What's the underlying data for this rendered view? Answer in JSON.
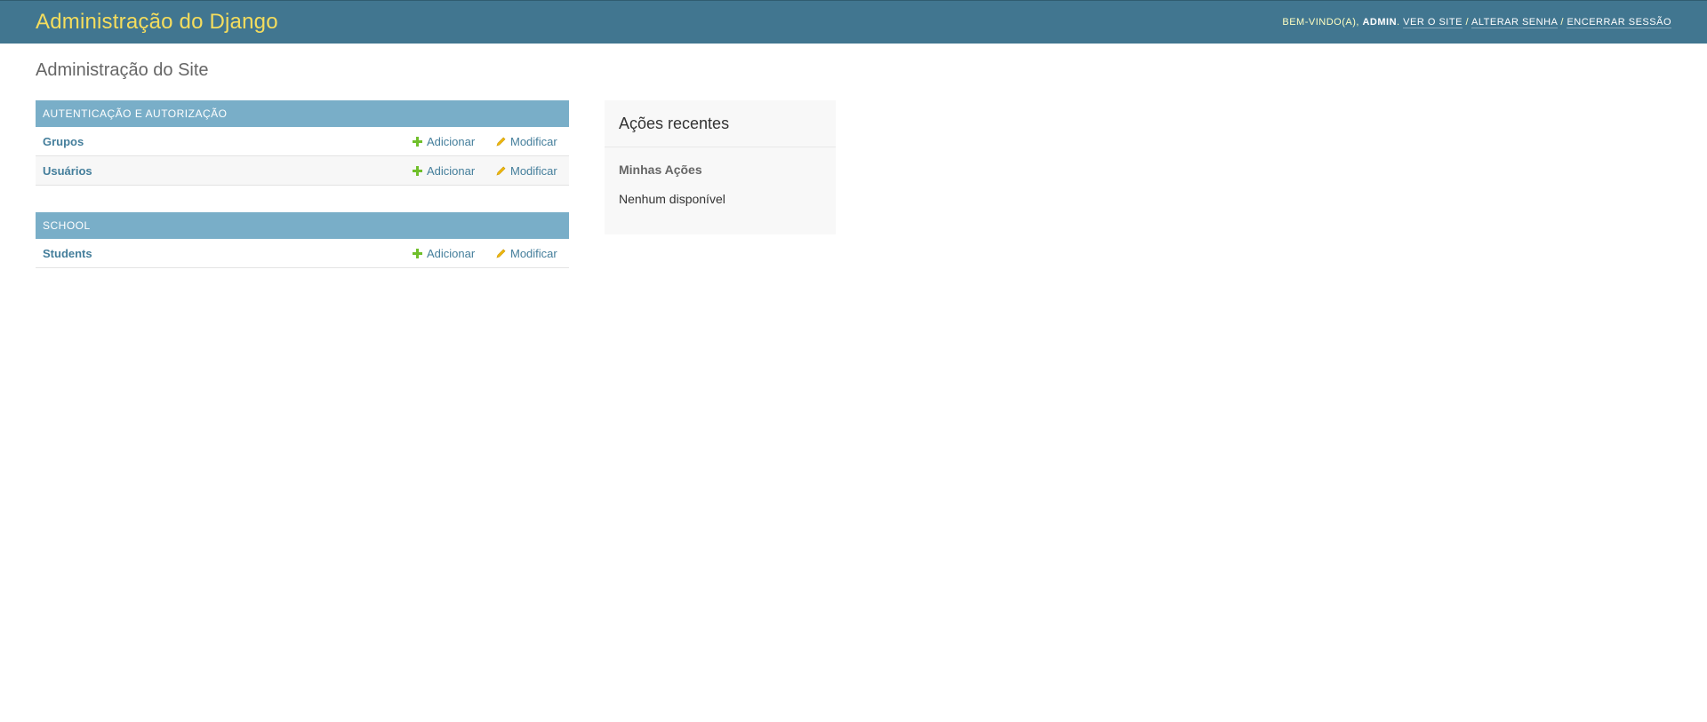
{
  "header": {
    "site_name": "Administração do Django",
    "welcome": "Bem-vindo(a), ",
    "username": "admin",
    "period": ".",
    "links": [
      {
        "label": "Ver o site"
      },
      {
        "label": "Alterar senha"
      },
      {
        "label": "Encerrar sessão"
      }
    ],
    "separator": "/"
  },
  "main": {
    "title": "Administração do Site",
    "apps": [
      {
        "caption": "Autenticação e Autorização",
        "models": [
          {
            "name": "Grupos",
            "add": "Adicionar",
            "change": "Modificar"
          },
          {
            "name": "Usuários",
            "add": "Adicionar",
            "change": "Modificar"
          }
        ]
      },
      {
        "caption": "School",
        "models": [
          {
            "name": "Students",
            "add": "Adicionar",
            "change": "Modificar"
          }
        ]
      }
    ]
  },
  "sidebar": {
    "title": "Ações recentes",
    "subtitle": "Minhas Ações",
    "empty_text": "Nenhum disponível"
  },
  "colors": {
    "header_bg": "#417690",
    "site_name": "#f5dd5d",
    "caption_bg": "#79aec8",
    "link": "#447e9b",
    "add_icon": "#70bf2b",
    "change_icon": "#efb80b"
  },
  "icons": {
    "add": "plus-icon",
    "change": "pencil-icon"
  }
}
